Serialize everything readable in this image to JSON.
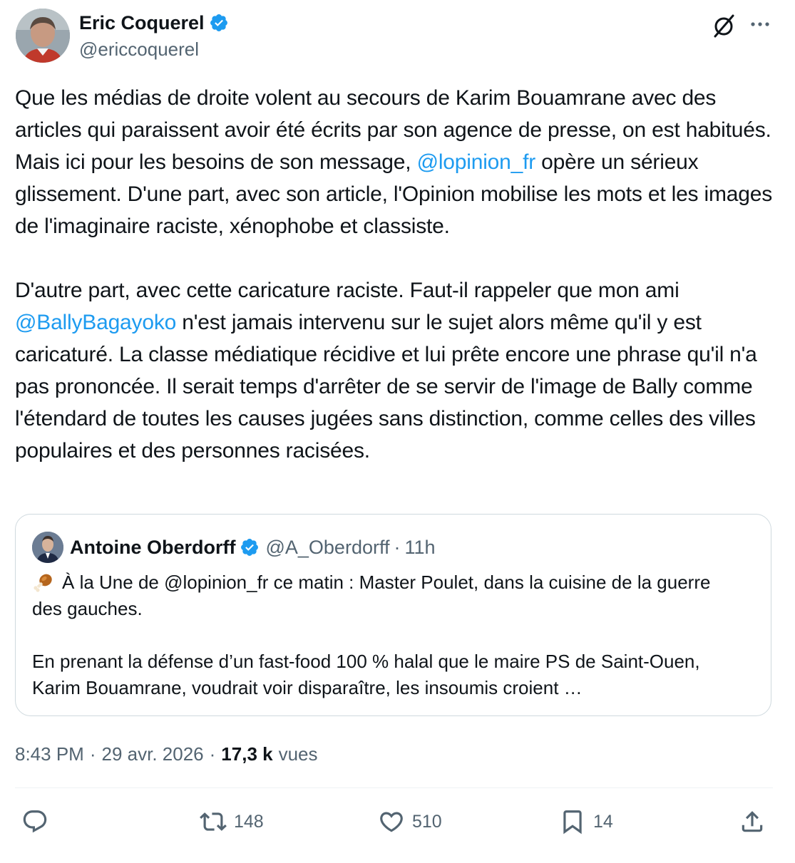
{
  "author": {
    "name": "Eric Coquerel",
    "handle": "@ericcoquerel",
    "avatar_icon": "profile-photo",
    "verified_color": "#1d9bf0"
  },
  "tweet": {
    "paragraph1": {
      "text_before": "Que les médias de droite volent au secours de Karim Bouamrane avec des articles qui paraissent avoir été écrits par son agence de presse, on est habitués. Mais ici pour les besoins de son message, ",
      "mention": "@lopinion_fr",
      "text_after": " opère un sérieux glissement. D'une part, avec son article, l'Opinion mobilise les mots et les images de l'imaginaire raciste, xénophobe et classiste."
    },
    "paragraph2": {
      "text_before": "D'autre part, avec cette caricature raciste. Faut-il rappeler que mon ami ",
      "mention": "@BallyBagayoko",
      "text_after": " n'est jamais intervenu sur le sujet alors même qu'il y est caricaturé. La classe médiatique récidive et lui prête encore une phrase qu'il n'a pas prononcée. Il serait temps d'arrêter de se servir de l'image de Bally comme l'étendard de toutes les causes jugées sans distinction, comme celles des villes populaires et des personnes racisées."
    }
  },
  "quote": {
    "name": "Antoine Oberdorff",
    "handle": "@A_Oberdorff",
    "dot": "·",
    "time": "11h",
    "line1": "À la Une de @lopinion_fr ce matin : Master Poulet, dans la cuisine de la guerre des gauches.",
    "line2": "En prenant la défense d’un fast-food 100 % halal que le maire PS de Saint-Ouen, Karim Bouamrane, voudrait voir disparaître, les insoumis croient …",
    "emoji_icon": "poultry-leg-icon"
  },
  "meta": {
    "time": "8:43 PM",
    "sep1": "·",
    "date": "29 avr. 2026",
    "sep2": "·",
    "views_count": "17,3 k",
    "views_label": "vues"
  },
  "actions": {
    "replies": "",
    "retweets": "148",
    "likes": "510",
    "bookmarks": "14"
  },
  "colors": {
    "text": "#0f1419",
    "secondary": "#536471",
    "link": "#1d9bf0",
    "border": "#cfd9de"
  }
}
